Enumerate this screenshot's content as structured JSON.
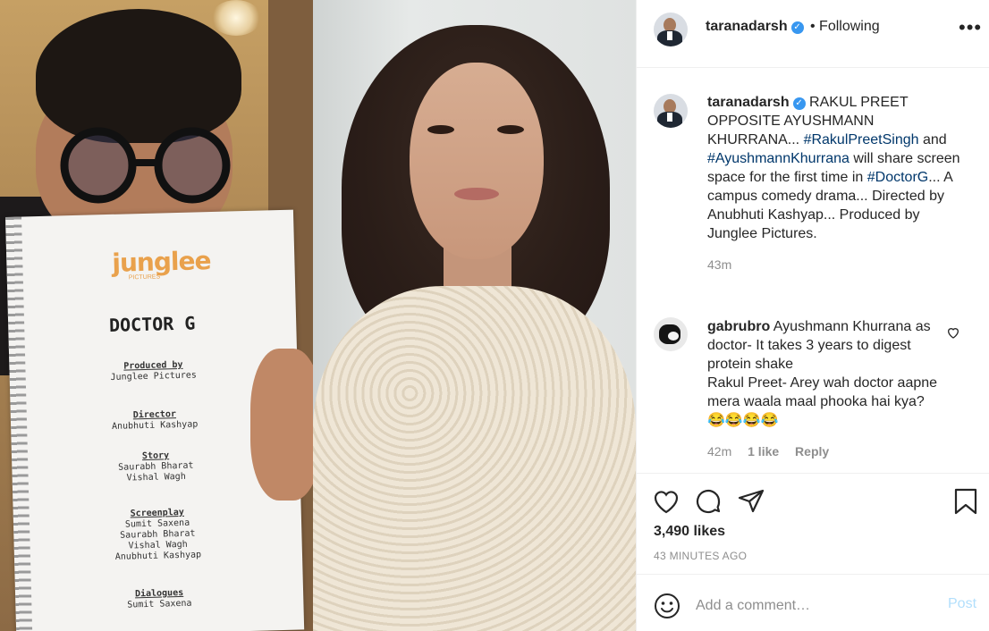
{
  "post_image": {
    "script_page": {
      "logo": "junglee",
      "logo_sub": "PICTURES",
      "title": "DOCTOR G",
      "credits": [
        {
          "head": "Produced by",
          "names": [
            "Junglee Pictures"
          ]
        },
        {
          "head": "Director",
          "names": [
            "Anubhuti Kashyap"
          ]
        },
        {
          "head": "Story",
          "names": [
            "Saurabh Bharat",
            "Vishal Wagh"
          ]
        },
        {
          "head": "Screenplay",
          "names": [
            "Sumit Saxena",
            "Saurabh Bharat",
            "Vishal Wagh",
            "Anubhuti Kashyap"
          ]
        },
        {
          "head": "Dialogues",
          "names": [
            "Sumit Saxena"
          ]
        }
      ]
    }
  },
  "header": {
    "username": "taranadarsh",
    "verified_icon": "✓",
    "follow_state": "• Following",
    "more_icon": "•••"
  },
  "caption": {
    "username": "taranadarsh",
    "text_1": "RAKUL PREET OPPOSITE AYUSHMANN KHURRANA...",
    "hashtag_1": "#RakulPreetSingh",
    "text_2": "and",
    "hashtag_2": "#AyushmannKhurrana",
    "text_3": "will share screen space for the first time in",
    "hashtag_3": "#DoctorG",
    "text_4": "... A campus comedy drama... Directed by Anubhuti Kashyap... Produced by Junglee Pictures.",
    "age": "43m"
  },
  "comment": {
    "username": "gabrubro",
    "text_1": "Ayushmann Khurrana as doctor- It takes 3 years to digest protein shake",
    "text_2": "Rakul Preet- Arey wah doctor aapne mera waala maal phooka hai kya?😂😂😂😂",
    "age": "42m",
    "likes": "1 like",
    "reply": "Reply"
  },
  "actions": {
    "likes": "3,490 likes",
    "timestamp": "43 MINUTES AGO"
  },
  "add_comment": {
    "placeholder": "Add a comment…",
    "post_label": "Post"
  },
  "colors": {
    "hashtag": "#00376b",
    "verified": "#3897f0",
    "post_disabled": "#b2dffc",
    "muted": "#8e8e8e"
  }
}
